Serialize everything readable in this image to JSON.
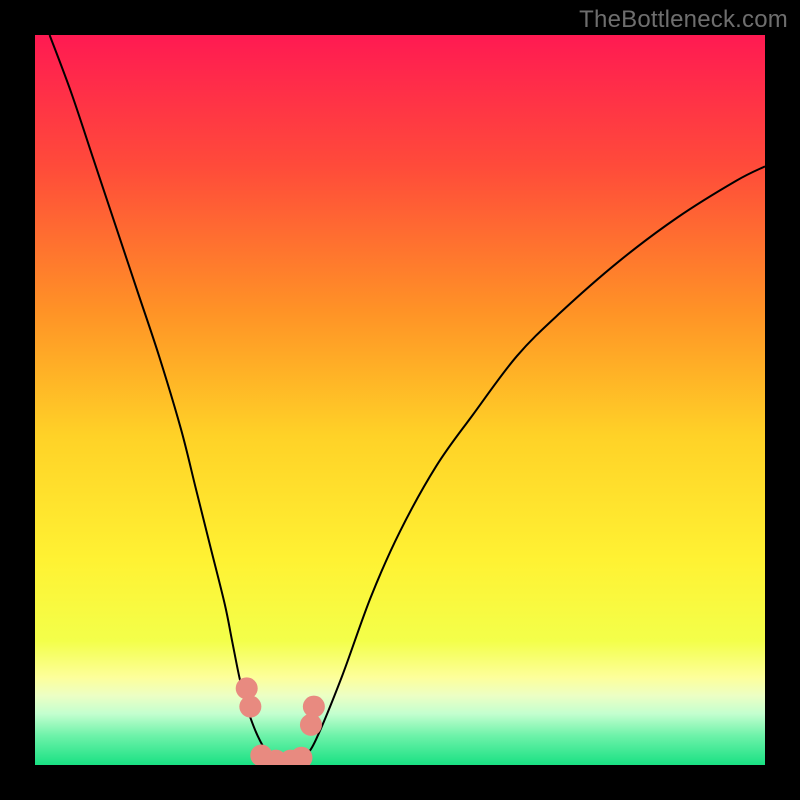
{
  "attribution": "TheBottleneck.com",
  "chart_data": {
    "type": "line",
    "title": "",
    "xlabel": "",
    "ylabel": "",
    "xlim": [
      0,
      100
    ],
    "ylim": [
      0,
      100
    ],
    "grid": false,
    "legend": false,
    "background_gradient": {
      "stops": [
        {
          "offset": 0.0,
          "color": "#ff1a52"
        },
        {
          "offset": 0.18,
          "color": "#ff4b3a"
        },
        {
          "offset": 0.38,
          "color": "#ff9326"
        },
        {
          "offset": 0.55,
          "color": "#ffd227"
        },
        {
          "offset": 0.72,
          "color": "#fff233"
        },
        {
          "offset": 0.83,
          "color": "#f3ff4a"
        },
        {
          "offset": 0.88,
          "color": "#fdff9b"
        },
        {
          "offset": 0.905,
          "color": "#ecffc4"
        },
        {
          "offset": 0.93,
          "color": "#c3ffcf"
        },
        {
          "offset": 0.96,
          "color": "#6df2a9"
        },
        {
          "offset": 1.0,
          "color": "#19e183"
        }
      ]
    },
    "series": [
      {
        "name": "bottleneck-curve",
        "stroke": "#000000",
        "stroke_width": 2,
        "x": [
          2,
          5,
          8,
          11,
          14,
          17,
          20,
          22,
          24,
          26,
          27,
          28,
          29,
          30.5,
          32,
          34,
          36,
          37,
          38.5,
          42,
          46,
          50,
          55,
          60,
          66,
          72,
          80,
          88,
          96,
          100
        ],
        "y": [
          100,
          92,
          83,
          74,
          65,
          56,
          46,
          38,
          30,
          22,
          17,
          12,
          8,
          4,
          1.5,
          0.2,
          0.2,
          1.2,
          3.5,
          12,
          23,
          32,
          41,
          48,
          56,
          62,
          69,
          75,
          80,
          82
        ]
      },
      {
        "name": "marker-dots",
        "type": "scatter",
        "color": "#e88a80",
        "radius": 11,
        "points": [
          {
            "x": 29.0,
            "y": 10.5
          },
          {
            "x": 29.5,
            "y": 8.0
          },
          {
            "x": 31.0,
            "y": 1.3
          },
          {
            "x": 33.0,
            "y": 0.6
          },
          {
            "x": 35.0,
            "y": 0.6
          },
          {
            "x": 36.5,
            "y": 1.0
          },
          {
            "x": 37.8,
            "y": 5.5
          },
          {
            "x": 38.2,
            "y": 8.0
          }
        ]
      }
    ]
  }
}
